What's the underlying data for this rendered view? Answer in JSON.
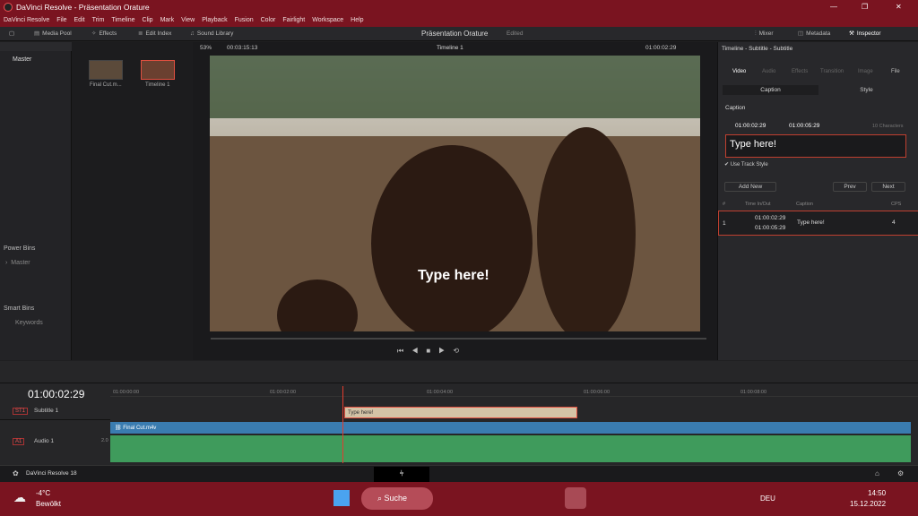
{
  "window": {
    "title": "DaVinci Resolve - Präsentation Orature",
    "min": "—",
    "max": "❐",
    "close": "✕"
  },
  "menu": [
    "DaVinci Resolve",
    "File",
    "Edit",
    "Trim",
    "Timeline",
    "Clip",
    "Mark",
    "View",
    "Playback",
    "Fusion",
    "Color",
    "Fairlight",
    "Workspace",
    "Help"
  ],
  "toolbar": {
    "media_pool": "Media Pool",
    "effects": "Effects",
    "edit_index": "Edit Index",
    "sound_library": "Sound Library",
    "project": "Präsentation Orature",
    "status": "Edited",
    "mixer": "Mixer",
    "metadata": "Metadata",
    "inspector": "Inspector"
  },
  "viewer_bar": {
    "zoom": "53%",
    "duration": "00:03:15:13",
    "timeline": "Timeline 1",
    "timecode": "01:00:02:29"
  },
  "bins": {
    "master": "Master",
    "power_bins": "Power Bins",
    "power_master": "Master",
    "smart_bins": "Smart Bins",
    "keywords": "Keywords"
  },
  "clips": [
    {
      "name": "Final Cut.m..."
    },
    {
      "name": "Timeline 1"
    }
  ],
  "subtitle_overlay": "Type here!",
  "inspector": {
    "title": "Timeline - Subtitle - Subtitle",
    "tabs": [
      "Video",
      "Audio",
      "Effects",
      "Transition",
      "Image",
      "File"
    ],
    "sub_tabs": [
      "Caption",
      "Style"
    ],
    "section": "Caption",
    "in_tc": "01:00:02:29",
    "out_tc": "01:00:05:29",
    "chars": "10 Characters",
    "text": "Type here!",
    "use_track_style": "Use Track Style",
    "add_new": "Add New",
    "prev": "Prev",
    "next": "Next",
    "table": {
      "headers": [
        "#",
        "Time In/Out",
        "Caption",
        "CPS"
      ],
      "rows": [
        {
          "num": "1",
          "in": "01:00:02:29",
          "out": "01:00:05:29",
          "caption": "Type here!",
          "cps": "4"
        }
      ]
    }
  },
  "timeline": {
    "timecode": "01:00:02:29",
    "ruler": [
      "01:00:00:00",
      "01:00:02:00",
      "01:00:04:00",
      "01:00:06:00",
      "01:00:08:00"
    ],
    "tracks": [
      {
        "id": "ST1",
        "name": "Subtitle 1"
      },
      {
        "id": "A1",
        "name": "Audio 1",
        "level": "2.0"
      }
    ],
    "subtitle_clip": "Type here!",
    "video_clip": "Final Cut.m4v"
  },
  "pagebar": {
    "app": "DaVinci Resolve 18"
  },
  "taskbar": {
    "temp": "-4°C",
    "weather": "Bewölkt",
    "search": "Suche",
    "lang": "DEU",
    "time": "14:50",
    "date": "15.12.2022"
  },
  "colors": {
    "accent": "#7a1420",
    "subtitle_clip": "#d4c3a6",
    "video_clip": "#3a7cb0",
    "audio_clip": "#3f9b5c",
    "playhead": "#e23c2e"
  }
}
